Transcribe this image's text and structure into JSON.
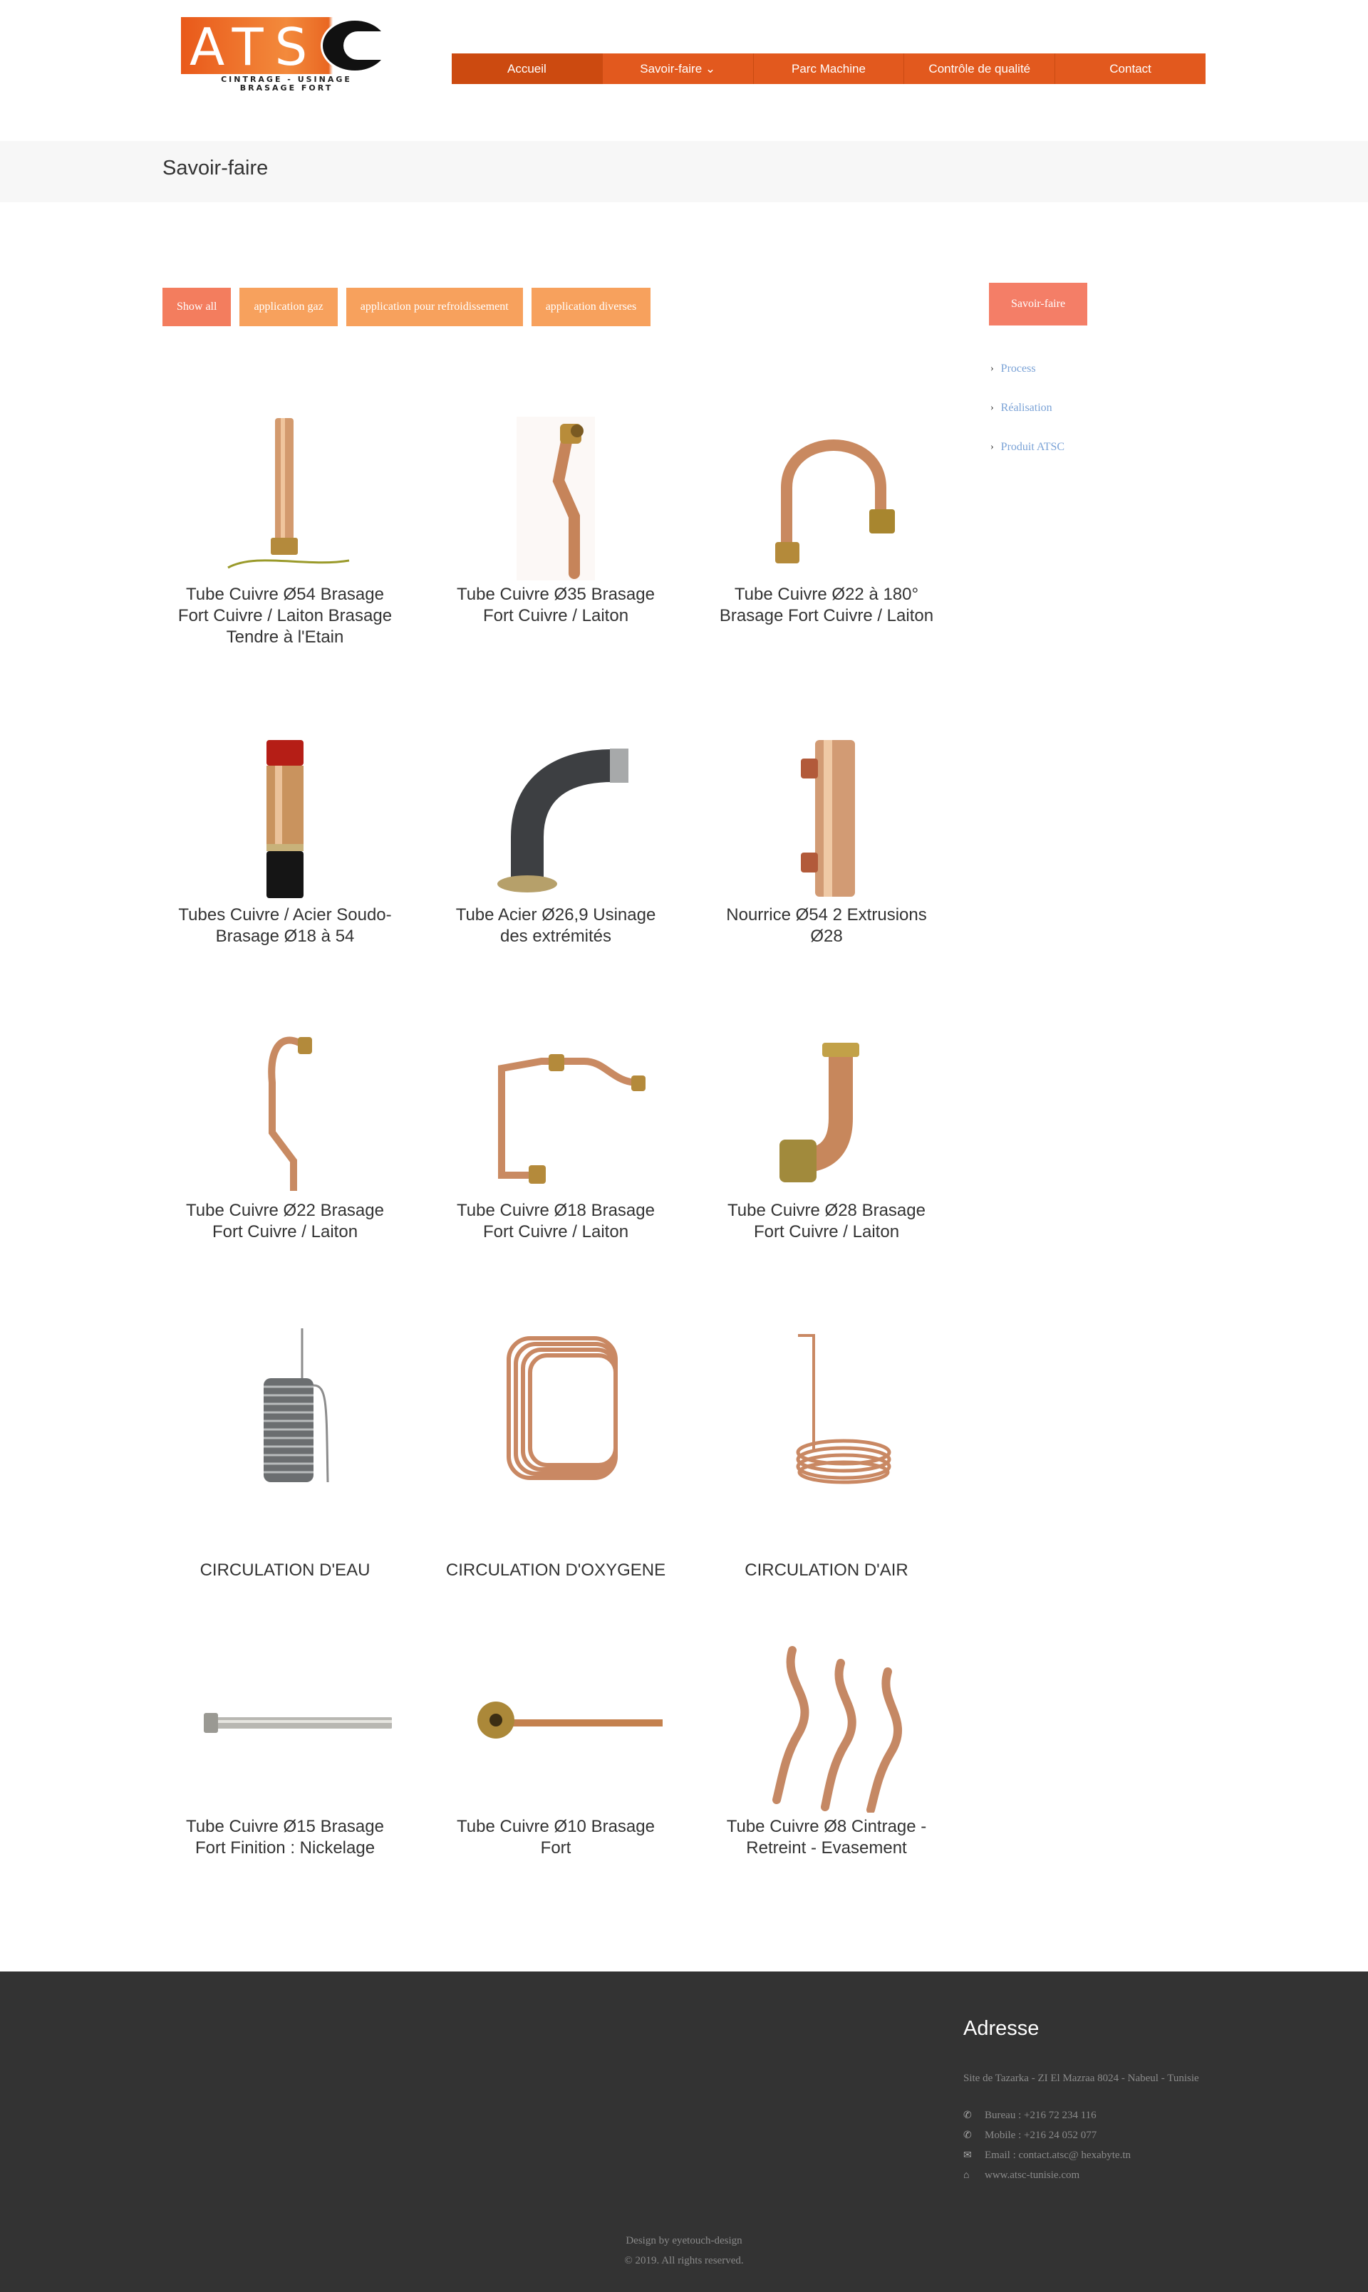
{
  "logo": {
    "word": "ATS",
    "tagline_1": "CINTRAGE - USINAGE",
    "tagline_2": "BRASAGE FORT"
  },
  "nav": {
    "items": [
      {
        "label": "Accueil",
        "active": true
      },
      {
        "label": "Savoir-faire ⌄",
        "active": false
      },
      {
        "label": "Parc Machine",
        "active": false
      },
      {
        "label": "Contrôle de qualité",
        "active": false
      },
      {
        "label": "Contact",
        "active": false
      }
    ]
  },
  "page": {
    "title": "Savoir-faire"
  },
  "filters": [
    {
      "label": "Show all",
      "active": true
    },
    {
      "label": "application gaz",
      "active": false
    },
    {
      "label": "application pour refroidissement",
      "active": false
    },
    {
      "label": "application diverses",
      "active": false
    }
  ],
  "sidebar": {
    "button": "Savoir-faire",
    "links": [
      "Process",
      "Réalisation",
      "Produit ATSC"
    ]
  },
  "products": [
    {
      "name": "Tube Cuivre Ø54 Brasage Fort Cuivre / Laiton Brasage Tendre à l'Etain",
      "icon": "straight-tube-icon"
    },
    {
      "name": "Tube Cuivre Ø35 Brasage Fort Cuivre / Laiton",
      "icon": "bent-tube-icon"
    },
    {
      "name": "Tube Cuivre Ø22 à 180° Brasage Fort Cuivre / Laiton",
      "icon": "u-bend-tube-icon"
    },
    {
      "name": "Tubes Cuivre / Acier Soudo-Brasage Ø18 à 54",
      "icon": "bimetal-tube-icon"
    },
    {
      "name": "Tube Acier Ø26,9 Usinage des extrémités",
      "icon": "steel-elbow-icon"
    },
    {
      "name": "Nourrice Ø54 2 Extrusions Ø28",
      "icon": "manifold-tube-icon"
    },
    {
      "name": "Tube Cuivre Ø22 Brasage Fort Cuivre / Laiton",
      "icon": "s-tube-icon"
    },
    {
      "name": "Tube Cuivre Ø18 Brasage Fort Cuivre / Laiton",
      "icon": "frame-tube-icon"
    },
    {
      "name": "Tube Cuivre Ø28 Brasage Fort Cuivre / Laiton",
      "icon": "elbow-fitting-icon"
    },
    {
      "name": "CIRCULATION D'EAU",
      "icon": "coil-icon"
    },
    {
      "name": "CIRCULATION D'OXYGENE",
      "icon": "loop-coil-icon"
    },
    {
      "name": "CIRCULATION D'AIR",
      "icon": "spiral-coil-icon"
    },
    {
      "name": "Tube Cuivre Ø15 Brasage Fort Finition : Nickelage",
      "icon": "nickel-tube-icon"
    },
    {
      "name": "Tube Cuivre Ø10 Brasage Fort",
      "icon": "banjo-tube-icon"
    },
    {
      "name": "Tube Cuivre Ø8 Cintrage - Retreint - Evasement",
      "icon": "wave-tubes-icon"
    }
  ],
  "footer": {
    "heading": "Adresse",
    "address": "Site de Tazarka - ZI El Mazraa 8024 - Nabeul - Tunisie",
    "phone_office": "Bureau : +216 72 234 116",
    "phone_mobile": "Mobile : +216 24 052 077",
    "email": "Email : contact.atsc@ hexabyte.tn",
    "website": "www.atsc-tunisie.com",
    "credit": "Design by eyetouch-design",
    "copyright": "© 2019. All rights reserved."
  },
  "colors": {
    "accent": "#e2591e",
    "filter": "#f7a15d",
    "filter_active": "#f37d5e",
    "footer_bg": "#333333",
    "link": "#7aa2d6"
  }
}
